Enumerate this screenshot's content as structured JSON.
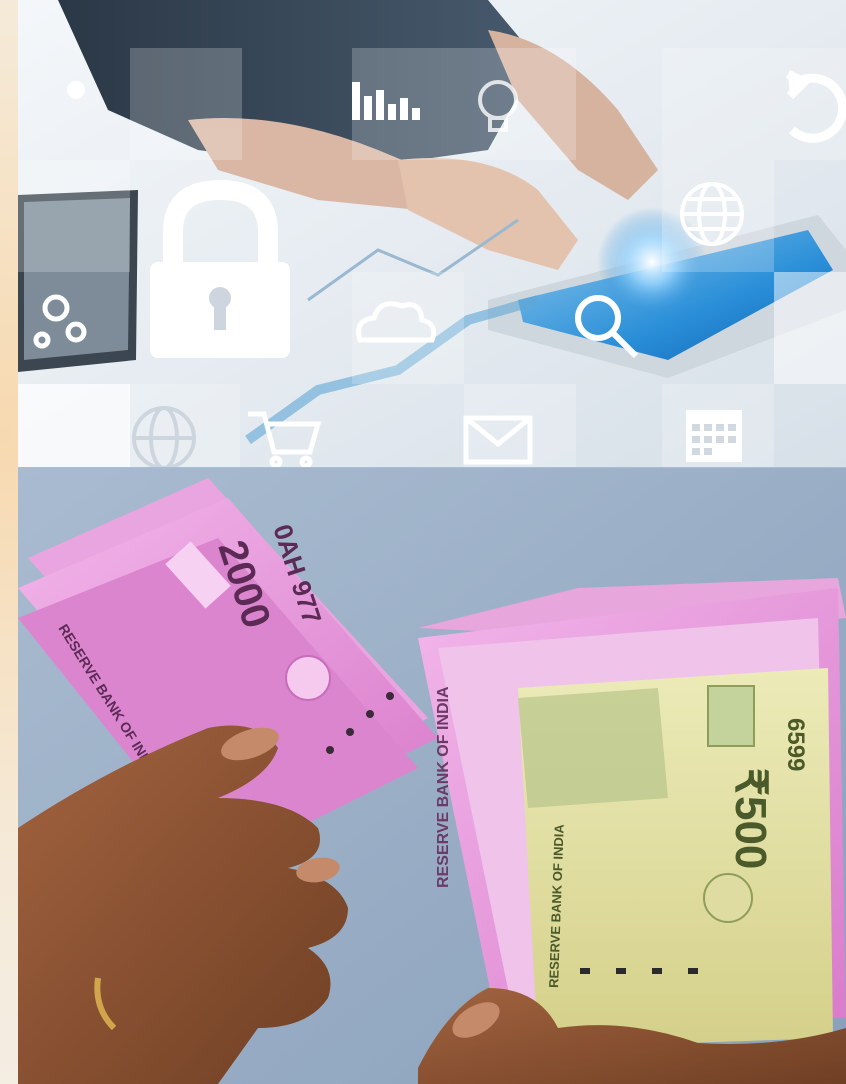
{
  "image": {
    "top_panel_subject": "security-technology-collage",
    "bottom_panel_subject": "indian-currency-notes-in-hands"
  },
  "notes": {
    "left_serial": "0AH 977",
    "left_denomination": "2000",
    "right_denomination": "₹500",
    "right_serial": "6599",
    "bank_name": "RESERVE BANK OF INDIA"
  },
  "colors": {
    "accent_blue": "#2a8fd8",
    "pink_note": "#e48fd6",
    "yellow_note": "#e2e0a4",
    "skin": "#8a5232",
    "backdrop": "#9fb1c8"
  },
  "icons": [
    "lock-icon",
    "gears-icon",
    "bar-chart-icon",
    "lightbulb-icon",
    "refresh-icon",
    "globe-icon",
    "cloud-icon",
    "magnifier-icon",
    "shopping-cart-icon",
    "mail-icon",
    "calendar-icon"
  ]
}
